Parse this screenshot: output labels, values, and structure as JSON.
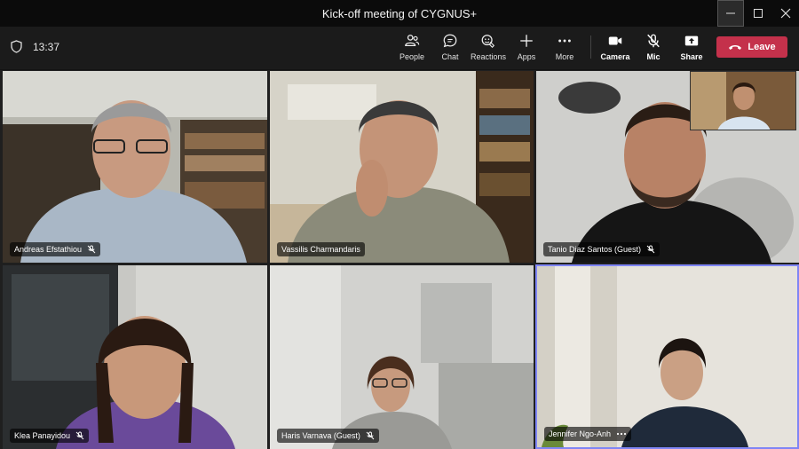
{
  "window": {
    "title": "Kick-off meeting of CYGNUS+",
    "controls": [
      "minimize",
      "maximize",
      "close"
    ]
  },
  "toolbar": {
    "time": "13:37",
    "items": [
      {
        "label": "People",
        "icon": "people-icon"
      },
      {
        "label": "Chat",
        "icon": "chat-icon"
      },
      {
        "label": "Reactions",
        "icon": "reactions-icon"
      },
      {
        "label": "Apps",
        "icon": "plus-icon"
      },
      {
        "label": "More",
        "icon": "more-icon"
      }
    ],
    "controls": [
      {
        "label": "Camera",
        "icon": "camera-icon"
      },
      {
        "label": "Mic",
        "icon": "mic-off-icon"
      },
      {
        "label": "Share",
        "icon": "share-icon"
      }
    ],
    "leave_label": "Leave",
    "accent_leave": "#c4314b"
  },
  "participants": [
    {
      "name": "Andreas Efstathiou",
      "muted": true
    },
    {
      "name": "Vassilis Charmandaris",
      "muted": false
    },
    {
      "name": "Tanio Diaz Santos (Guest)",
      "muted": true
    },
    {
      "name": "Klea Panayidou",
      "muted": true
    },
    {
      "name": "Haris Varnava (Guest)",
      "muted": true
    },
    {
      "name": "Jennifer Ngo-Anh",
      "muted": false,
      "active": true
    }
  ],
  "active_speaker_color": "#7f85f5"
}
